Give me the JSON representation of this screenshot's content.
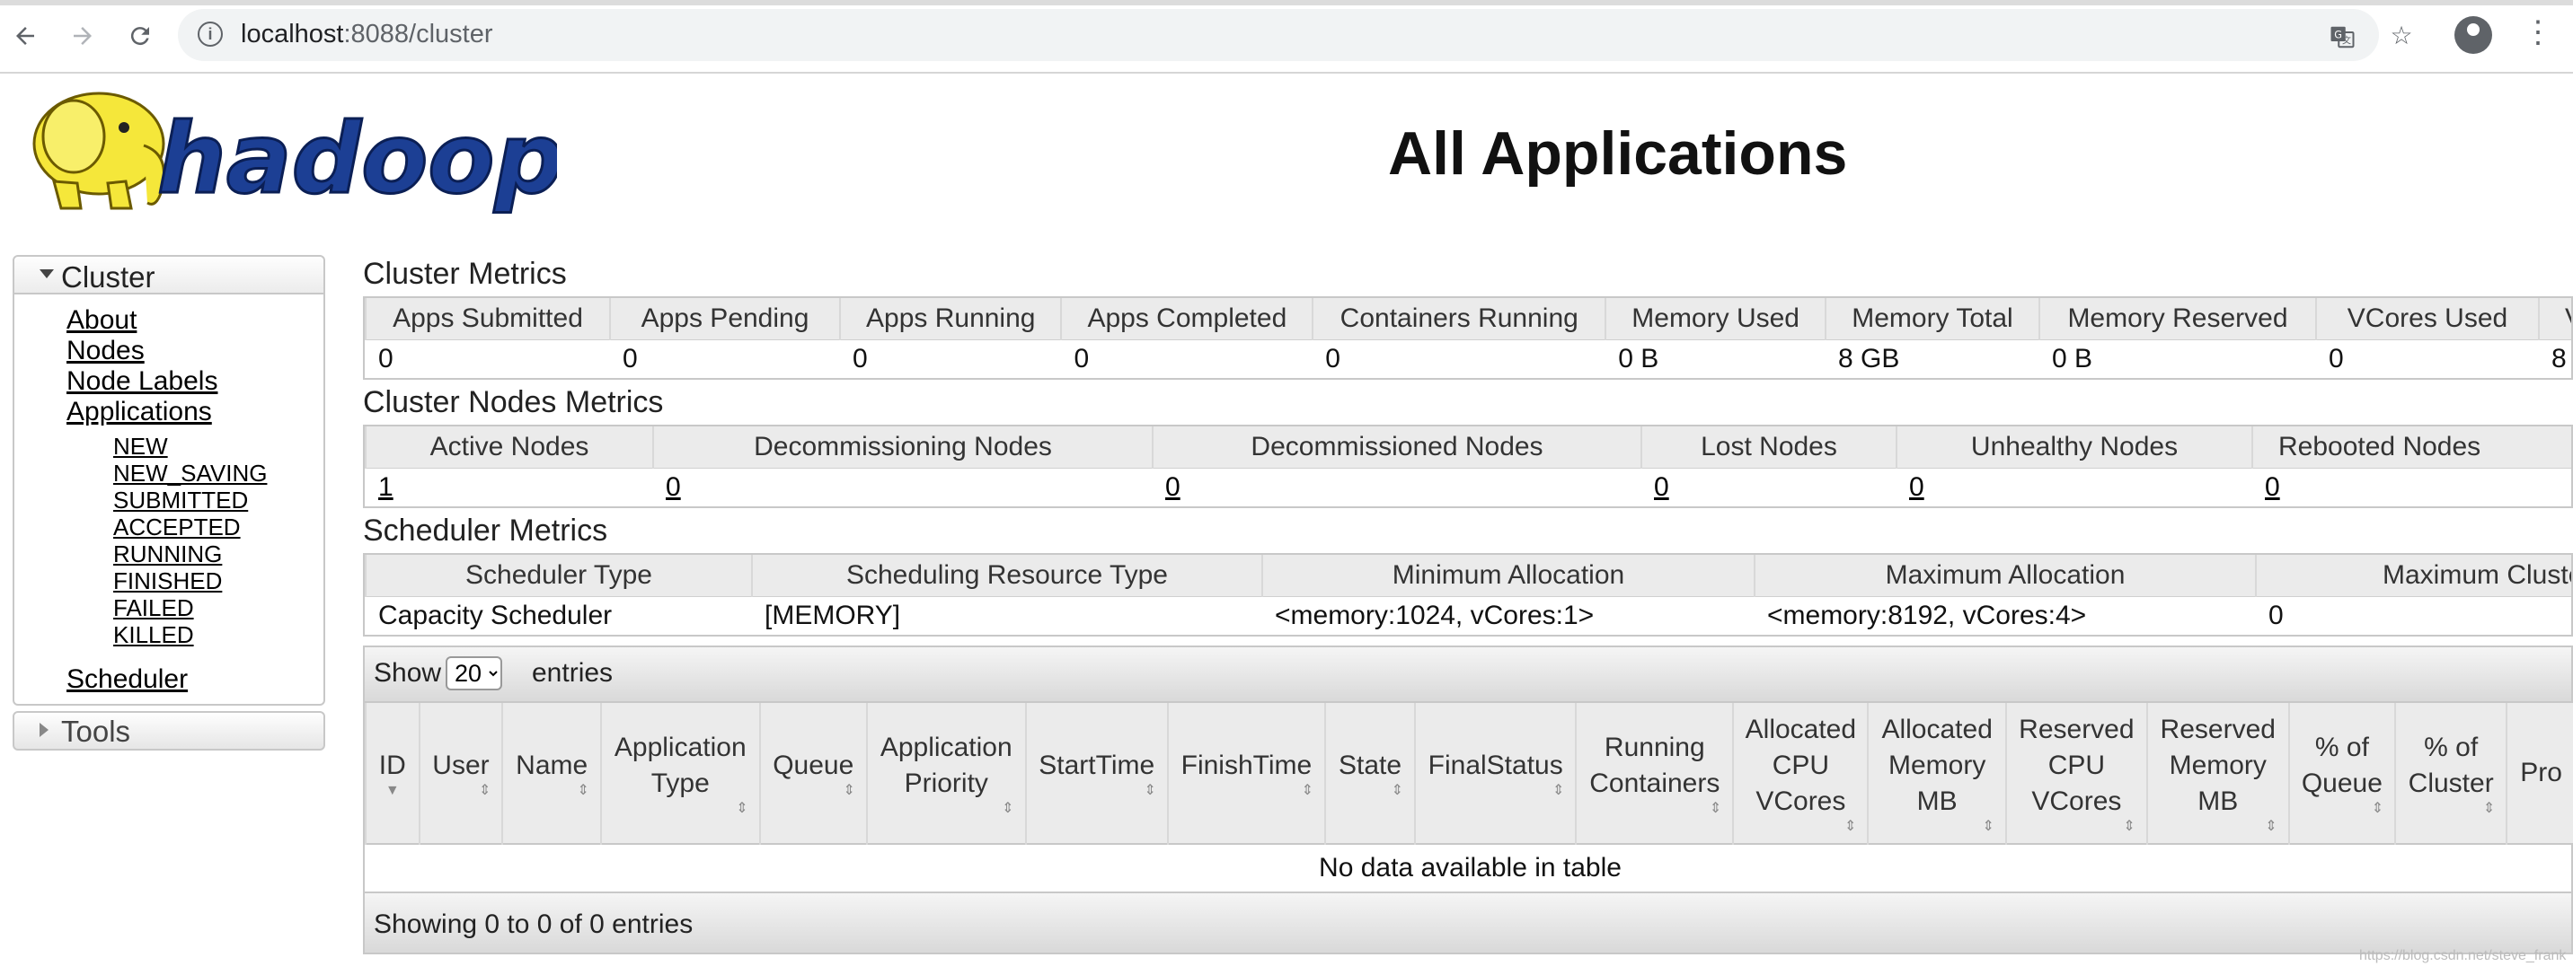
{
  "browser": {
    "url_host": "localhost",
    "url_path": ":8088/cluster"
  },
  "header": {
    "logo_text": "hadoop",
    "page_title": "All Applications"
  },
  "sidebar": {
    "cluster_label": "Cluster",
    "links": [
      "About",
      "Nodes",
      "Node Labels",
      "Applications"
    ],
    "app_states": [
      "NEW",
      "NEW_SAVING",
      "SUBMITTED",
      "ACCEPTED",
      "RUNNING",
      "FINISHED",
      "FAILED",
      "KILLED"
    ],
    "scheduler_label": "Scheduler",
    "tools_label": "Tools"
  },
  "cluster_metrics": {
    "title": "Cluster Metrics",
    "headers": [
      "Apps Submitted",
      "Apps Pending",
      "Apps Running",
      "Apps Completed",
      "Containers Running",
      "Memory Used",
      "Memory Total",
      "Memory Reserved",
      "VCores Used",
      "VCore"
    ],
    "values": [
      "0",
      "0",
      "0",
      "0",
      "0",
      "0 B",
      "8 GB",
      "0 B",
      "0",
      "8"
    ]
  },
  "node_metrics": {
    "title": "Cluster Nodes Metrics",
    "headers": [
      "Active Nodes",
      "Decommissioning Nodes",
      "Decommissioned Nodes",
      "Lost Nodes",
      "Unhealthy Nodes",
      "Rebooted Nodes"
    ],
    "values": [
      "1",
      "0",
      "0",
      "0",
      "0",
      "0"
    ]
  },
  "scheduler_metrics": {
    "title": "Scheduler Metrics",
    "headers": [
      "Scheduler Type",
      "Scheduling Resource Type",
      "Minimum Allocation",
      "Maximum Allocation",
      "Maximum Cluste"
    ],
    "values": [
      "Capacity Scheduler",
      "[MEMORY]",
      "<memory:1024, vCores:1>",
      "<memory:8192, vCores:4>",
      "0"
    ]
  },
  "apps_table": {
    "show_label": "Show",
    "page_size": "20",
    "entries_label": "entries",
    "columns": [
      [
        "ID"
      ],
      [
        "User"
      ],
      [
        "Name"
      ],
      [
        "Application",
        "Type"
      ],
      [
        "Queue"
      ],
      [
        "Application",
        "Priority"
      ],
      [
        "StartTime"
      ],
      [
        "FinishTime"
      ],
      [
        "State"
      ],
      [
        "FinalStatus"
      ],
      [
        "Running",
        "Containers"
      ],
      [
        "Allocated",
        "CPU",
        "VCores"
      ],
      [
        "Allocated",
        "Memory",
        "MB"
      ],
      [
        "Reserved",
        "CPU",
        "VCores"
      ],
      [
        "Reserved",
        "Memory",
        "MB"
      ],
      [
        "% of",
        "Queue"
      ],
      [
        "% of",
        "Cluster"
      ],
      [
        "Pro"
      ]
    ],
    "empty_message": "No data available in table",
    "footer": "Showing 0 to 0 of 0 entries"
  },
  "watermark": "https://blog.csdn.net/steve_frank",
  "colors": {
    "header_bg": "#ebebeb",
    "border": "#c8c8c8",
    "logo_yellow": "#f5e73a",
    "logo_blue": "#1c3f94"
  }
}
